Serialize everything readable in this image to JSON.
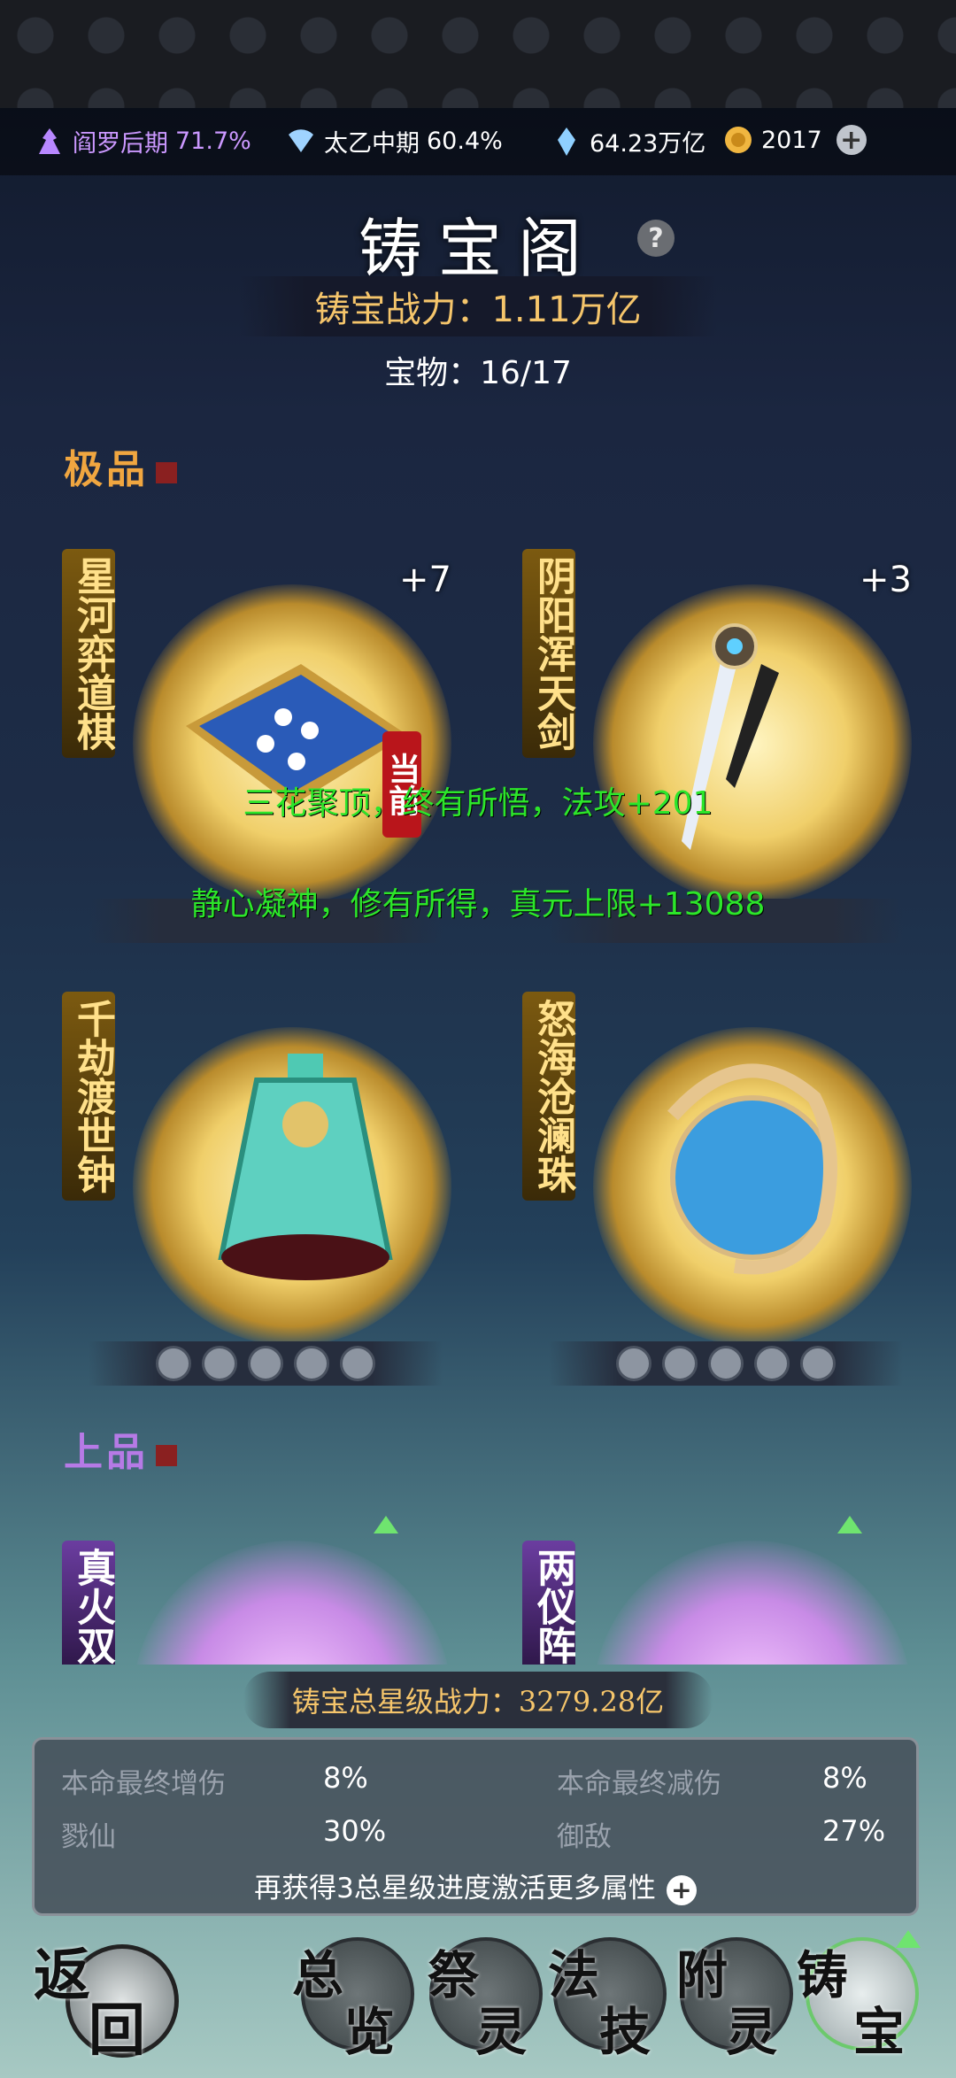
{
  "topbar": {
    "realm": "阎罗后期",
    "realm_pct": "71.7%",
    "stage": "太乙中期",
    "stage_pct": "60.4%",
    "crystal": "64.23万亿",
    "coins": "2017"
  },
  "title": "铸宝阁",
  "power_label": "铸宝战力：1.11万亿",
  "treasure_count": "宝物：16/17",
  "section_top": "极品",
  "section_mid": "上品",
  "items": [
    {
      "name": "星河弈道棋",
      "level": "+7"
    },
    {
      "name": "阴阳浑天剑",
      "level": "+3"
    },
    {
      "name": "千劫渡世钟",
      "level": ""
    },
    {
      "name": "怒海沧澜珠",
      "level": ""
    },
    {
      "name": "真火双",
      "level": ""
    },
    {
      "name": "两仪阵",
      "level": ""
    }
  ],
  "current_tag": "当前",
  "float_messages": [
    "三花聚顶，终有所悟，法攻+201",
    "静心凝神，修有所得，真元上限+13088"
  ],
  "total_star_power": "铸宝总星级战力：3279.28亿",
  "stats": [
    {
      "label": "本命最终增伤",
      "value": "8%"
    },
    {
      "label": "本命最终减伤",
      "value": "8%"
    },
    {
      "label": "戮仙",
      "value": "30%"
    },
    {
      "label": "御敌",
      "value": "27%"
    }
  ],
  "more_attrs": "再获得3总星级进度激活更多属性",
  "nav": {
    "back": [
      "返",
      "回"
    ],
    "overview": [
      "总",
      "览"
    ],
    "sacrifice": [
      "祭",
      "灵"
    ],
    "skill": [
      "法",
      "技"
    ],
    "attach": [
      "附",
      "灵"
    ],
    "forge": [
      "铸",
      "宝"
    ]
  },
  "colors": {
    "gold": "#f5c56b",
    "green_text": "#2ce62a",
    "purple": "#cb98ff"
  }
}
